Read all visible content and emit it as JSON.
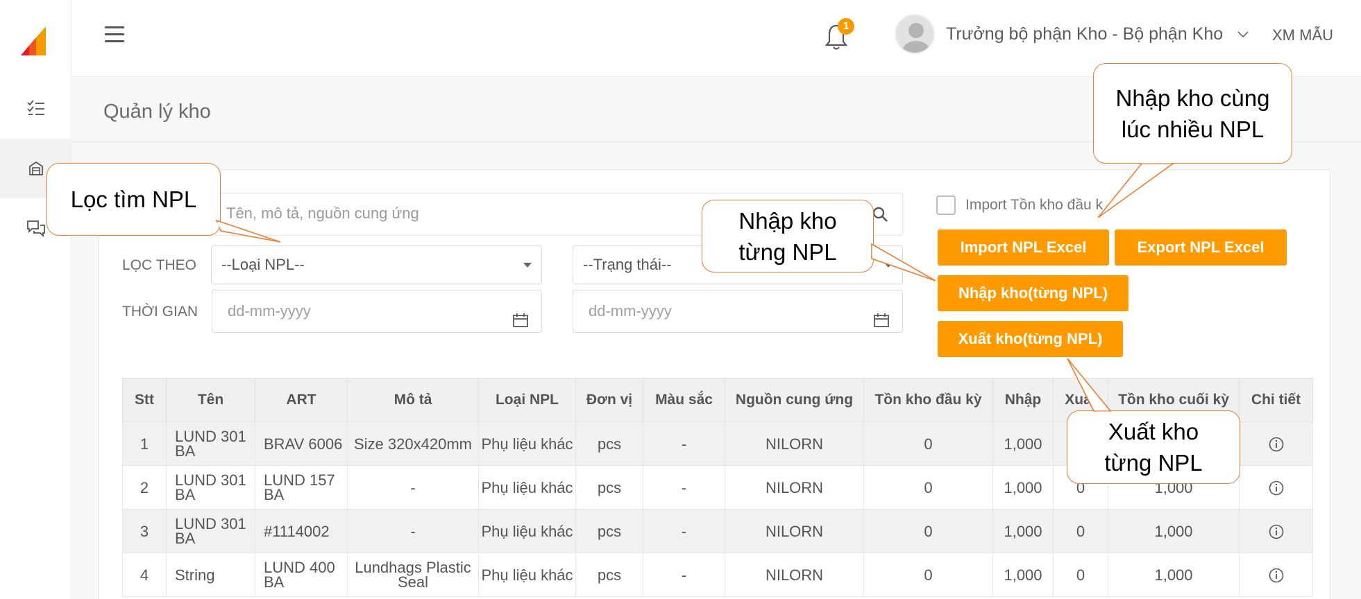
{
  "header": {
    "notification_count": "1",
    "user_name": "Trưởng bộ phận Kho - Bộ phận Kho",
    "org_name": "XM MẪU"
  },
  "page": {
    "title": "Quản lý kho"
  },
  "filters": {
    "search_placeholder": "Tên, mô tả, nguồn cung ứng",
    "filter_label": "LỌC THEO",
    "time_label": "THỜI GIAN",
    "type_select": "--Loại NPL--",
    "status_select": "--Trạng thái--",
    "date_from_placeholder": "dd-mm-yyyy",
    "date_to_placeholder": "dd-mm-yyyy"
  },
  "actions": {
    "import_opening_label": "Import Tồn kho đầu k",
    "import_excel": "Import NPL Excel",
    "export_excel": "Export NPL Excel",
    "import_single": "Nhập kho(từng NPL)",
    "export_single": "Xuất kho(từng NPL)"
  },
  "table": {
    "columns": [
      "Stt",
      "Tên",
      "ART",
      "Mô tả",
      "Loại NPL",
      "Đơn vị",
      "Màu sắc",
      "Nguồn cung ứng",
      "Tồn kho đầu kỳ",
      "Nhập",
      "Xuất",
      "Tồn kho cuối kỳ",
      "Chi tiết"
    ],
    "rows": [
      [
        "1",
        "LUND 301 BA",
        "BRAV 6006",
        "Size 320x420mm",
        "Phụ liệu khác",
        "pcs",
        "-",
        "NILORN",
        "0",
        "1,000",
        "",
        "",
        ""
      ],
      [
        "2",
        "LUND 301 BA",
        "LUND 157 BA",
        "-",
        "Phụ liệu khác",
        "pcs",
        "-",
        "NILORN",
        "0",
        "1,000",
        "0",
        "1,000",
        ""
      ],
      [
        "3",
        "LUND 301 BA",
        "#1114002",
        "-",
        "Phụ liệu khác",
        "pcs",
        "-",
        "NILORN",
        "0",
        "1,000",
        "0",
        "1,000",
        ""
      ],
      [
        "4",
        "String",
        "LUND 400 BA",
        "Lundhags Plastic Seal",
        "Phụ liệu khác",
        "pcs",
        "-",
        "NILORN",
        "0",
        "1,000",
        "0",
        "1,000",
        ""
      ]
    ]
  },
  "callouts": {
    "filter": "Lọc tìm NPL",
    "bulk_import": "Nhập kho cùng lúc nhiều  NPL",
    "single_import": "Nhập kho từng NPL",
    "single_export": "Xuất kho từng NPL"
  },
  "colors": {
    "accent": "#ff9a00",
    "callout_border": "#ed7d31"
  }
}
